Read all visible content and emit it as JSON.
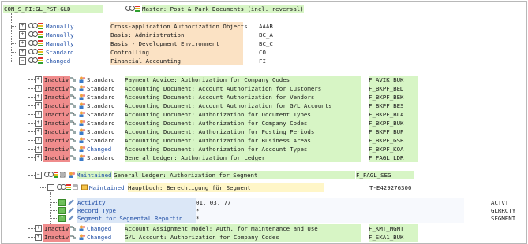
{
  "header": {
    "id": "CON_S_FI:GL_PST-GLD",
    "title": "Master: Post & Park Documents (incl. reversal)"
  },
  "top_nodes": [
    {
      "status": "Manually",
      "desc": "Cross-application Authorization Objects",
      "code": "AAAB",
      "color": "#e57b2a"
    },
    {
      "status": "Manually",
      "desc": "Basis: Administration",
      "code": "BC_A",
      "color": "#e57b2a"
    },
    {
      "status": "Manually",
      "desc": "Basis - Development Environment",
      "code": "BC_C",
      "color": "#e57b2a"
    },
    {
      "status": "Standard",
      "desc": "Controlling",
      "code": "CO",
      "color": "#e57b2a"
    },
    {
      "status": "Changed",
      "desc": "Financial Accounting",
      "code": "FI",
      "color": "#e57b2a"
    }
  ],
  "objects": [
    {
      "flag": "Inactiv",
      "status": "Standard",
      "desc": "Payment Advice: Authorization for Company Codes",
      "code": "F_AVIK_BUK"
    },
    {
      "flag": "Inactiv",
      "status": "Standard",
      "desc": "Accounting Document: Account Authorization for Customers",
      "code": "F_BKPF_BED"
    },
    {
      "flag": "Inactiv",
      "status": "Standard",
      "desc": "Accounting Document: Account Authorization for Vendors",
      "code": "F_BKPF_BEK"
    },
    {
      "flag": "Inactiv",
      "status": "Standard",
      "desc": "Accounting Document: Account Authorization for G/L Accounts",
      "code": "F_BKPF_BES"
    },
    {
      "flag": "Inactiv",
      "status": "Standard",
      "desc": "Accounting Document: Authorization for Document Types",
      "code": "F_BKPF_BLA"
    },
    {
      "flag": "Inactiv",
      "status": "Standard",
      "desc": "Accounting Document: Authorization for Company Codes",
      "code": "F_BKPF_BUK"
    },
    {
      "flag": "Inactiv",
      "status": "Standard",
      "desc": "Accounting Document: Authorization for Posting Periods",
      "code": "F_BKPF_BUP"
    },
    {
      "flag": "Inactiv",
      "status": "Standard",
      "desc": "Accounting Document: Authorization for Business Areas",
      "code": "F_BKPF_GSB"
    },
    {
      "flag": "Inactiv",
      "status": "Changed",
      "desc": "Accounting Document: Authorization for Account Types",
      "code": "F_BKPF_KOA"
    },
    {
      "flag": "Inactiv",
      "status": "Standard",
      "desc": "General Ledger: Authorization for Ledger",
      "code": "F_FAGL_LDR"
    }
  ],
  "segment_object": {
    "status": "Maintained",
    "desc": "General Ledger: Authorization for Segment",
    "code": "F_FAGL_SEG"
  },
  "auth": {
    "status": "Maintained",
    "desc": "Hauptbuch: Berechtigung für Segment",
    "code": "T-E429276300"
  },
  "fields": [
    {
      "name": "Activity",
      "value": "01, 03, 77",
      "code": "ACTVT"
    },
    {
      "name": "Record Type",
      "value": "*",
      "code": "GLRRCTY"
    },
    {
      "name": "Segment for Segmental Reportin",
      "value": "*",
      "code": "SEGMENT"
    }
  ],
  "bottom_objects": [
    {
      "flag": "Inactiv",
      "status": "Changed",
      "desc": "Account Assignment Model: Auth. for Maintenance and Use",
      "code": "F_KMT_MGMT"
    },
    {
      "flag": "Inactiv",
      "status": "Changed",
      "desc": "G/L Account: Authorization for Company Codes",
      "code": "F_SKA1_BUK"
    }
  ]
}
